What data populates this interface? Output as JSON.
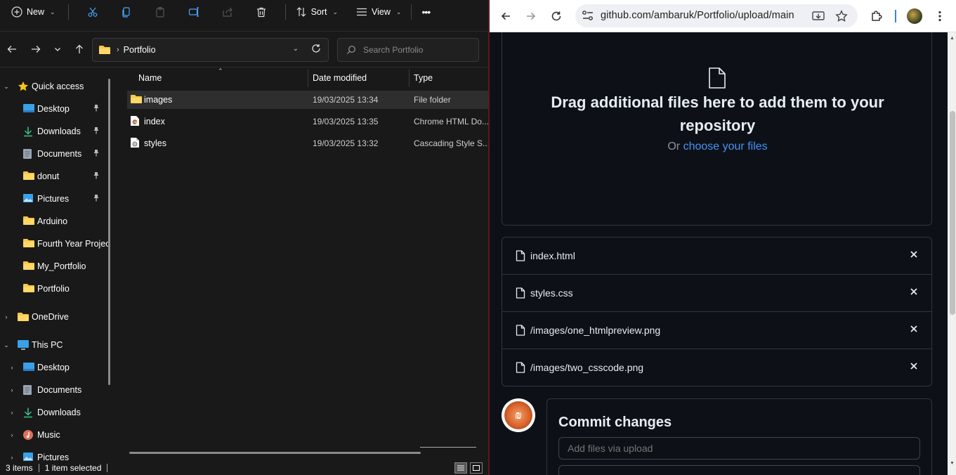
{
  "explorer": {
    "cmdbar": {
      "new_label": "New",
      "sort_label": "Sort",
      "view_label": "View",
      "more_label": "•••"
    },
    "address": {
      "current_folder": "Portfolio"
    },
    "search": {
      "placeholder": "Search Portfolio"
    },
    "nav": {
      "quick_access": "Quick access",
      "items": [
        {
          "label": "Desktop",
          "icon": "desktop-icon",
          "pinned": true
        },
        {
          "label": "Downloads",
          "icon": "download-icon",
          "pinned": true
        },
        {
          "label": "Documents",
          "icon": "document-icon",
          "pinned": true
        },
        {
          "label": "donut",
          "icon": "folder-icon",
          "pinned": true
        },
        {
          "label": "Pictures",
          "icon": "pictures-icon",
          "pinned": true
        },
        {
          "label": "Arduino",
          "icon": "folder-icon",
          "pinned": false
        },
        {
          "label": "Fourth Year Projec",
          "icon": "folder-icon",
          "pinned": false
        },
        {
          "label": "My_Portfolio",
          "icon": "folder-icon",
          "pinned": false
        },
        {
          "label": "Portfolio",
          "icon": "folder-icon",
          "pinned": false
        }
      ],
      "onedrive": "OneDrive",
      "this_pc": "This PC",
      "pc_items": [
        {
          "label": "Desktop",
          "icon": "desktop-icon"
        },
        {
          "label": "Documents",
          "icon": "document-icon"
        },
        {
          "label": "Downloads",
          "icon": "download-icon"
        },
        {
          "label": "Music",
          "icon": "music-icon"
        },
        {
          "label": "Pictures",
          "icon": "pictures-icon"
        }
      ]
    },
    "columns": {
      "name": "Name",
      "date": "Date modified",
      "type": "Type"
    },
    "files": [
      {
        "name": "images",
        "date": "19/03/2025 13:34",
        "type": "File folder",
        "icon": "folder-icon",
        "selected": true
      },
      {
        "name": "index",
        "date": "19/03/2025 13:35",
        "type": "Chrome HTML Do...",
        "icon": "chrome-html-icon",
        "selected": false
      },
      {
        "name": "styles",
        "date": "19/03/2025 13:32",
        "type": "Cascading Style S...",
        "icon": "css-file-icon",
        "selected": false
      }
    ],
    "status": {
      "count": "3 items",
      "selected": "1 item selected"
    }
  },
  "browser": {
    "url": "github.com/ambaruk/Portfolio/upload/main",
    "dropzone": {
      "title": "Drag additional files here to add them to your repository",
      "or_text": "Or",
      "choose_link": "choose your files"
    },
    "uploaded_files": [
      "index.html",
      "styles.css",
      "/images/one_htmlpreview.png",
      "/images/two_csscode.png"
    ],
    "commit": {
      "title": "Commit changes",
      "placeholder": "Add files via upload"
    }
  },
  "colors": {
    "explorer_bg": "#191919",
    "github_bg": "#0d1117",
    "github_link": "#4493f8",
    "github_border": "#30363d",
    "folder_yellow": "#f8c84a"
  }
}
